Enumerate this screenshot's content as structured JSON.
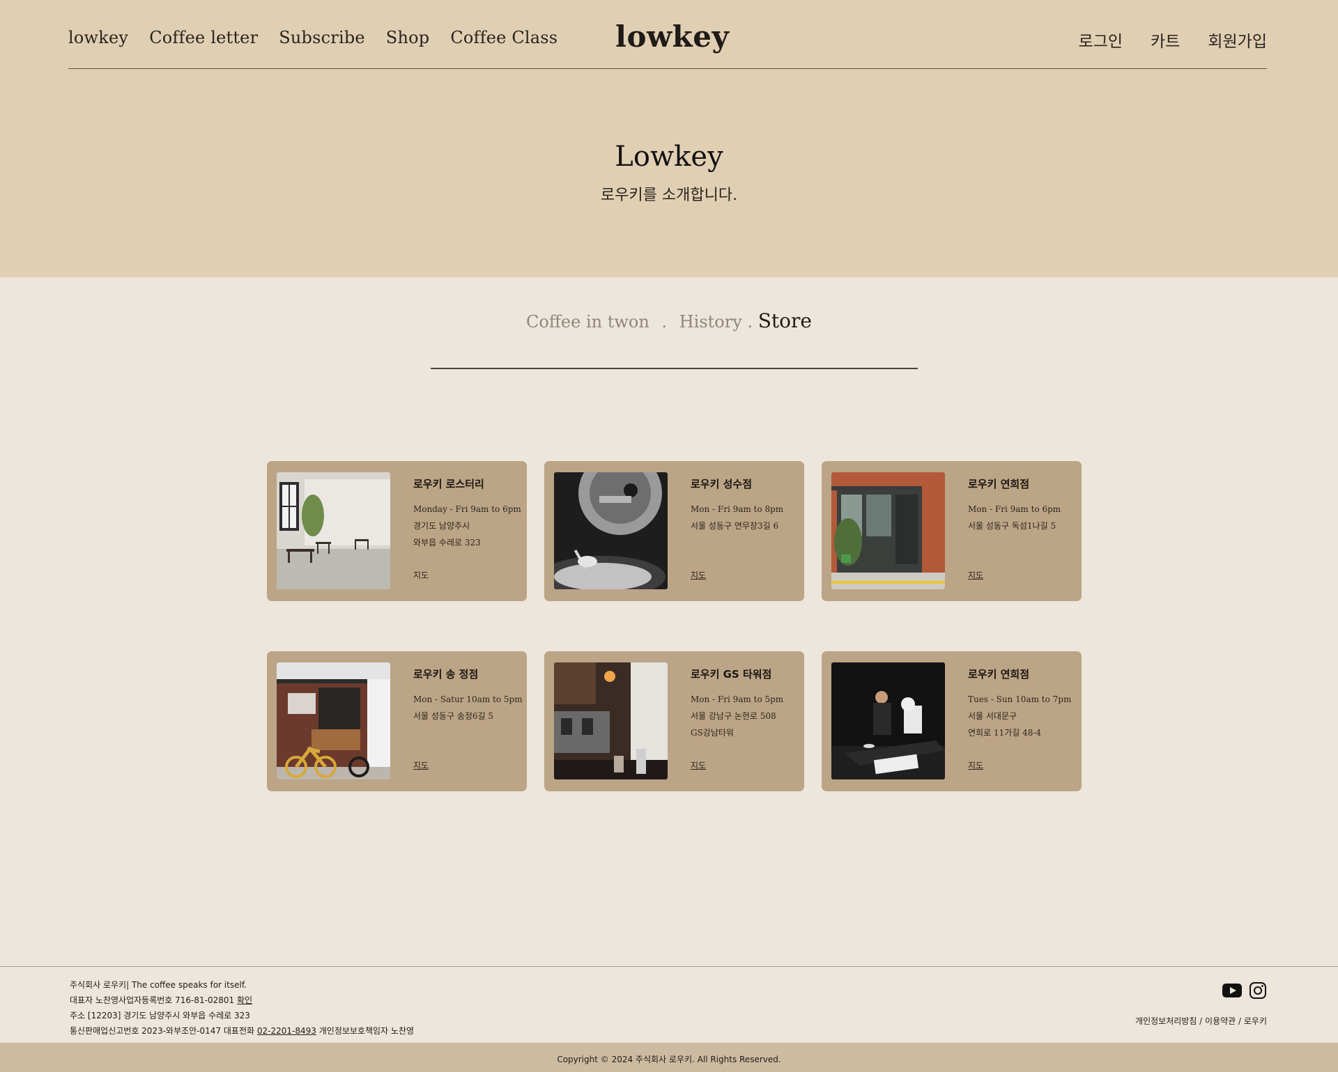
{
  "nav": {
    "left": [
      "lowkey",
      "Coffee letter",
      "Subscribe",
      "Shop",
      "Coffee Class"
    ],
    "logo": "lowkey",
    "right": [
      "로그인",
      "카트",
      "회원가입"
    ]
  },
  "hero": {
    "title": "Lowkey",
    "subtitle": "로우키를 소개합니다."
  },
  "tabs": {
    "t1": "Coffee in twon",
    "t2": "History",
    "t3": "Store",
    "sep": "."
  },
  "stores": [
    {
      "name": "로우키 로스터리",
      "lines": [
        "Monday - Fri 9am to 6pm",
        "경기도 남양주시",
        "와부읍 수레로 323"
      ],
      "map": "지도"
    },
    {
      "name": "로우키 성수점",
      "lines": [
        "Mon - Fri 9am to 8pm",
        "서울 성동구 연무장3길 6"
      ],
      "map": "지도"
    },
    {
      "name": "로우키 연희점",
      "lines": [
        "Mon - Fri 9am to 6pm",
        "서울 성동구 독섬1나길 5"
      ],
      "map": "지도"
    },
    {
      "name": "로우키 송 정점",
      "lines": [
        "Mon - Satur 10am to 5pm",
        "서울 성동구 송정6길 5"
      ],
      "map": "지도"
    },
    {
      "name": "로우키 GS 타워점",
      "lines": [
        "Mon - Fri 9am to 5pm",
        "서울 강남구 논현로 508",
        "GS강남타워"
      ],
      "map": "지도"
    },
    {
      "name": "로우키 연희점",
      "lines": [
        "Tues - Sun 10am to 7pm",
        "서울 서대문구",
        "연희로 11가길 48-4"
      ],
      "map": "지도"
    }
  ],
  "footer": {
    "l1": "주식회사 로우키| The coffee speaks for itself.",
    "l2a": "대표자 노찬영사업자등록번호 716-81-02801",
    "l2b": "확인",
    "l3": "주소 [12203] 경기도 남양주시 와부읍 수레로 323",
    "l4a": "통신판매업신고번호 2023-와부조안-0147  대표전화",
    "l4b": "02-2201-8493",
    "l4c": "개인정보보호책임자 노찬영",
    "policy": "개인정보처리방침 / 이용약관 / 로우키",
    "copyright": "Copyright © 2024 주식회사 로우키. All Rights Reserved."
  },
  "icons": [
    "youtube-icon",
    "instagram-icon"
  ]
}
